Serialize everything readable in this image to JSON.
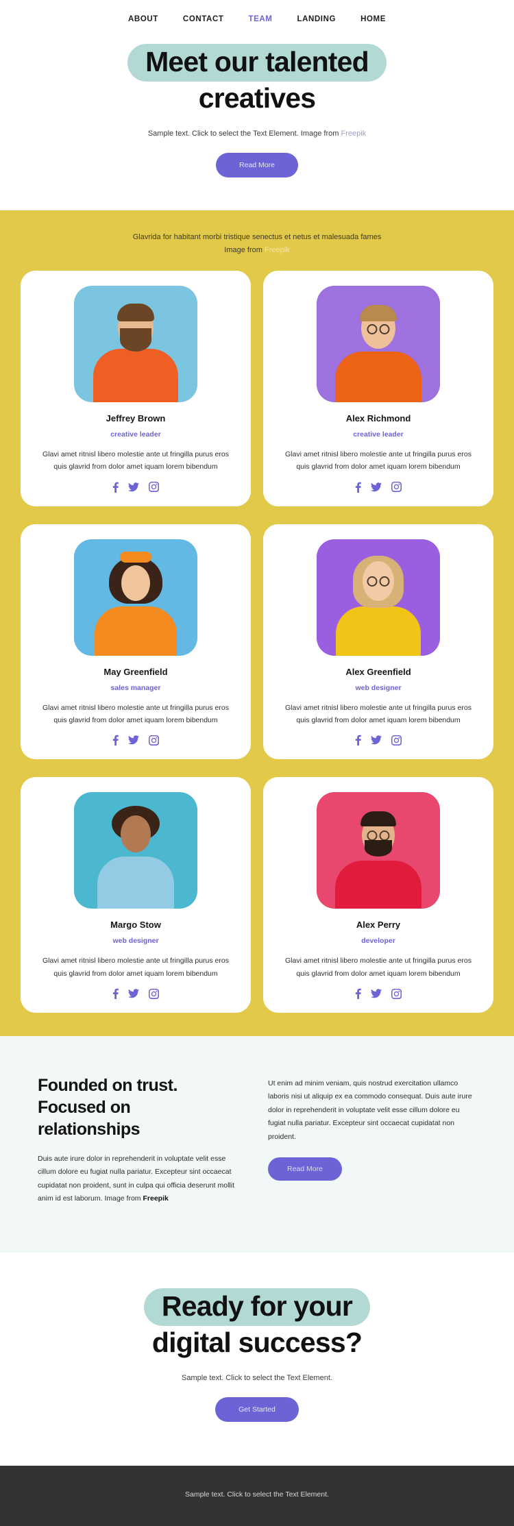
{
  "nav": {
    "items": [
      {
        "label": "ABOUT",
        "active": false
      },
      {
        "label": "CONTACT",
        "active": false
      },
      {
        "label": "TEAM",
        "active": true
      },
      {
        "label": "LANDING",
        "active": false
      },
      {
        "label": "HOME",
        "active": false
      }
    ]
  },
  "hero": {
    "title_line1": "Meet our talented",
    "title_line2": "creatives",
    "subtitle": "Sample text. Click to select the Text Element. Image from",
    "subtitle_link": "Freepik",
    "button": "Read More"
  },
  "team": {
    "intro_line1": "Glavrida for habitant morbi tristique senectus et netus et malesuada fames",
    "intro_line2": "Image from",
    "intro_link": "Freepik",
    "members": [
      {
        "name": "Jeffrey Brown",
        "role": "creative leader",
        "text": "Glavi amet ritnisl libero molestie ante ut fringilla purus eros quis glavrid from dolor amet iquam lorem bibendum",
        "photo_bg": "#7cc5e0",
        "shirt": "#ef5f23",
        "skin": "#e8b98f",
        "hair": "#6b4526"
      },
      {
        "name": "Alex Richmond",
        "role": "creative leader",
        "text": "Glavi amet ritnisl libero molestie ante ut fringilla purus eros quis glavrid from dolor amet iquam lorem bibendum",
        "photo_bg": "#9d72de",
        "shirt": "#ed6316",
        "skin": "#eec19b",
        "hair": "#b98a4e"
      },
      {
        "name": "May Greenfield",
        "role": "sales manager",
        "text": "Glavi amet ritnisl libero molestie ante ut fringilla purus eros quis glavrid from dolor amet iquam lorem bibendum",
        "photo_bg": "#63b9e3",
        "shirt": "#f58a1f",
        "skin": "#f0c59c",
        "hair": "#3a2318"
      },
      {
        "name": "Alex Greenfield",
        "role": "web designer",
        "text": "Glavi amet ritnisl libero molestie ante ut fringilla purus eros quis glavrid from dolor amet iquam lorem bibendum",
        "photo_bg": "#9a5ee0",
        "shirt": "#f2c417",
        "skin": "#f2cba6",
        "hair": "#d8b177"
      },
      {
        "name": "Margo Stow",
        "role": "web designer",
        "text": "Glavi amet ritnisl libero molestie ante ut fringilla purus eros quis glavrid from dolor amet iquam lorem bibendum",
        "photo_bg": "#4bb8cf",
        "shirt": "#93cbe4",
        "skin": "#b27a52",
        "hair": "#3a2418"
      },
      {
        "name": "Alex Perry",
        "role": "developer",
        "text": "Glavi amet ritnisl libero molestie ante ut fringilla purus eros quis glavrid from dolor amet iquam lorem bibendum",
        "photo_bg": "#e8486e",
        "shirt": "#e01b3c",
        "skin": "#e5b38b",
        "hair": "#2c1d14"
      }
    ],
    "social_icons": [
      "facebook-icon",
      "twitter-icon",
      "instagram-icon"
    ]
  },
  "founded": {
    "title_line1": "Founded on trust.",
    "title_line2": "Focused on",
    "title_line3": "relationships",
    "left_text": "Duis aute irure dolor in reprehenderit in voluptate velit esse cillum dolore eu fugiat nulla pariatur. Excepteur sint occaecat cupidatat non proident, sunt in culpa qui officia deserunt mollit anim id est laborum. Image from ",
    "left_text_bold": "Freepik",
    "right_text": "Ut enim ad minim veniam, quis nostrud exercitation ullamco laboris nisi ut aliquip ex ea commodo consequat. Duis aute irure dolor in reprehenderit in voluptate velit esse cillum dolore eu fugiat nulla pariatur. Excepteur sint occaecat cupidatat non proident.",
    "button": "Read More"
  },
  "cta": {
    "title_line1": "Ready for your",
    "title_line2": "digital success?",
    "subtitle": "Sample text. Click to select the Text Element.",
    "button": "Get Started"
  },
  "footer": {
    "text": "Sample text. Click to select the Text Element."
  },
  "colors": {
    "accent_purple": "#6c63d6",
    "highlight_teal": "#b3d9d4",
    "section_yellow": "#e3c94a",
    "founded_bg": "#f2f8f7",
    "footer_bg": "#333333"
  }
}
